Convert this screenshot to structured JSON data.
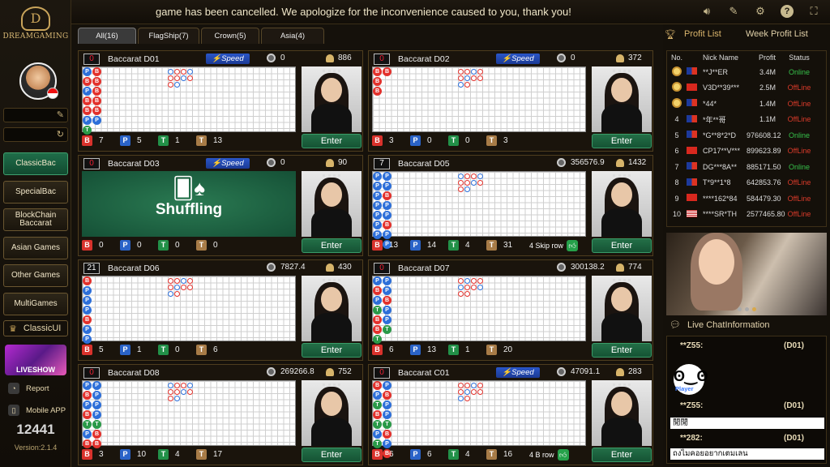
{
  "brand": {
    "name": "DREAMGAMING",
    "emblem": "D"
  },
  "user": {
    "balance": "12441",
    "version": "Version:2.1.4"
  },
  "sidebar": {
    "items": [
      "ClassicBac",
      "SpecialBac",
      "BlockChain Baccarat",
      "Asian Games",
      "Other Games",
      "MultiGames"
    ],
    "classic_ui": "ClassicUI",
    "liveshow": "LIVESHOW",
    "report": "Report",
    "mobile": "Mobile APP"
  },
  "marquee": "game has been cancelled. We apologize for the inconvenience caused to you, thank you!",
  "tabs": [
    "All(16)",
    "FlagShip(7)",
    "Crown(5)",
    "Asia(4)"
  ],
  "tables": [
    {
      "count": "0",
      "name": "Baccarat D01",
      "speed": true,
      "chips": "0",
      "players": "886",
      "B": "7",
      "P": "5",
      "T": "1",
      "Tb": "13",
      "shuffling": false,
      "enter": "Enter",
      "skip": ""
    },
    {
      "count": "0",
      "name": "Baccarat D02",
      "speed": true,
      "chips": "0",
      "players": "372",
      "B": "3",
      "P": "0",
      "T": "0",
      "Tb": "3",
      "shuffling": false,
      "enter": "Enter",
      "skip": ""
    },
    {
      "count": "0",
      "name": "Baccarat D03",
      "speed": true,
      "chips": "0",
      "players": "90",
      "B": "0",
      "P": "0",
      "T": "0",
      "Tb": "0",
      "shuffling": true,
      "enter": "Enter",
      "skip": ""
    },
    {
      "count": "7",
      "name": "Baccarat D05",
      "speed": false,
      "chips": "356576.9",
      "players": "1432",
      "B": "13",
      "P": "14",
      "T": "4",
      "Tb": "31",
      "shuffling": false,
      "enter": "Enter",
      "skip": "4 Skip row"
    },
    {
      "count": "21",
      "name": "Baccarat D06",
      "speed": false,
      "chips": "7827.4",
      "players": "430",
      "B": "5",
      "P": "1",
      "T": "0",
      "Tb": "6",
      "shuffling": false,
      "enter": "Enter",
      "skip": ""
    },
    {
      "count": "0",
      "name": "Baccarat D07",
      "speed": false,
      "chips": "300138.2",
      "players": "774",
      "B": "6",
      "P": "13",
      "T": "1",
      "Tb": "20",
      "shuffling": false,
      "enter": "Enter",
      "skip": ""
    },
    {
      "count": "0",
      "name": "Baccarat D08",
      "speed": false,
      "chips": "269266.8",
      "players": "752",
      "B": "3",
      "P": "10",
      "T": "4",
      "Tb": "17",
      "shuffling": false,
      "enter": "Enter",
      "skip": ""
    },
    {
      "count": "0",
      "name": "Baccarat C01",
      "speed": true,
      "chips": "47091.1",
      "players": "283",
      "B": "6",
      "P": "6",
      "T": "4",
      "Tb": "16",
      "shuffling": false,
      "enter": "Enter",
      "skip": "4 B row"
    }
  ],
  "speed_label": "Speed",
  "shuffling_label": "Shuffling",
  "profit": {
    "tab1": "Profit List",
    "tab2": "Week Profit List",
    "headers": [
      "No.",
      "Nick Name",
      "Profit",
      "Status"
    ],
    "rows": [
      {
        "no": "1",
        "flag": "TW",
        "nick": "**J**ER",
        "profit": "3.4M",
        "status": "Online"
      },
      {
        "no": "2",
        "flag": "VN",
        "nick": "V3D**39***",
        "profit": "2.5M",
        "status": "OffLine"
      },
      {
        "no": "3",
        "flag": "TW",
        "nick": "*44*",
        "profit": "1.4M",
        "status": "OffLine"
      },
      {
        "no": "4",
        "flag": "TW",
        "nick": "*年**哥",
        "profit": "1.1M",
        "status": "OffLine"
      },
      {
        "no": "5",
        "flag": "TW",
        "nick": "*G**8*2*D",
        "profit": "976608.12",
        "status": "Online"
      },
      {
        "no": "6",
        "flag": "VN",
        "nick": "CP17**V***",
        "profit": "899623.89",
        "status": "OffLine"
      },
      {
        "no": "7",
        "flag": "TW",
        "nick": "DG***8A**",
        "profit": "885171.50",
        "status": "Online"
      },
      {
        "no": "8",
        "flag": "TW",
        "nick": "T*9**1*8",
        "profit": "642853.76",
        "status": "OffLine"
      },
      {
        "no": "9",
        "flag": "VN",
        "nick": "****162*84",
        "profit": "584479.30",
        "status": "OffLine"
      },
      {
        "no": "10",
        "flag": "US",
        "nick": "****SR*TH",
        "profit": "2577465.80",
        "status": "OffLine"
      }
    ]
  },
  "chat": {
    "title": "Live ChatInformation",
    "messages": [
      {
        "who": "**Z55:",
        "table": "(D01)",
        "text": "",
        "sticker": "Player"
      },
      {
        "who": "**Z55:",
        "table": "(D01)",
        "text": "閒閒"
      },
      {
        "who": "**282:",
        "table": "(D01)",
        "text": "ถงไมคอยอยากเตมเลน"
      }
    ]
  }
}
